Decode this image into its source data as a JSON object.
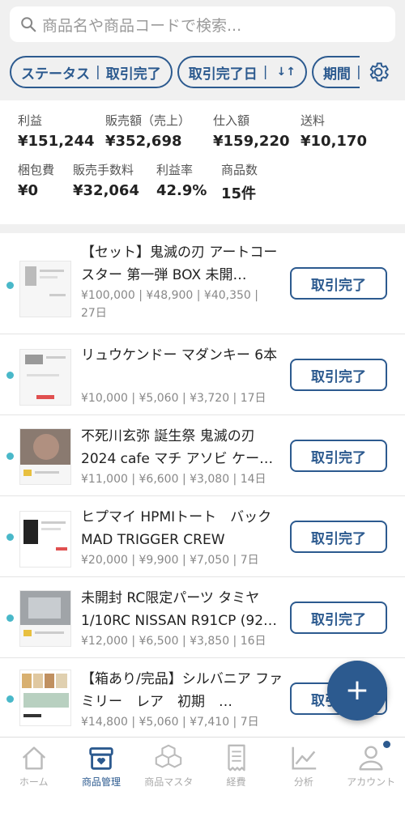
{
  "search": {
    "placeholder": "商品名や商品コードで検索..."
  },
  "filters": [
    {
      "label": "ステータス",
      "value": "取引完了"
    },
    {
      "label": "取引完了日",
      "sort": "↓↑"
    },
    {
      "label": "期間"
    }
  ],
  "summary": {
    "row1": [
      {
        "label": "利益",
        "value": "¥151,244"
      },
      {
        "label": "販売額（売上）",
        "value": "¥352,698"
      },
      {
        "label": "仕入額",
        "value": "¥159,220"
      },
      {
        "label": "送料",
        "value": "¥10,170"
      }
    ],
    "row2": [
      {
        "label": "梱包費",
        "value": "¥0"
      },
      {
        "label": "販売手数料",
        "value": "¥32,064"
      },
      {
        "label": "利益率",
        "value": "42.9%"
      },
      {
        "label": "商品数",
        "value": "15件"
      }
    ]
  },
  "items": [
    {
      "title": "【セット】鬼滅の刃 アートコースター 第一弾 BOX 未開…",
      "meta1": "¥100,000 | ¥48,900 | ¥40,350 |",
      "meta2": "27日",
      "status": "取引完了"
    },
    {
      "title": "リュウケンドー マダンキー 6本",
      "meta1": "¥10,000 | ¥5,060 | ¥3,720 | 17日",
      "meta2": "",
      "status": "取引完了"
    },
    {
      "title": "不死川玄弥 誕生祭 鬼滅の刃 2024 cafe マチ アソビ ケー…",
      "meta1": "¥11,000 | ¥6,600 | ¥3,080 | 14日",
      "meta2": "",
      "status": "取引完了"
    },
    {
      "title": "ヒプマイ HPMIトート　バック　MAD TRIGGER CREW",
      "meta1": "¥20,000 | ¥9,900 | ¥7,050 | 7日",
      "meta2": "",
      "status": "取引完了"
    },
    {
      "title": "未開封 RC限定パーツ タミヤ 1/10RC NISSAN R91CP (92…",
      "meta1": "¥12,000 | ¥6,500 | ¥3,850 | 16日",
      "meta2": "",
      "status": "取引完了"
    },
    {
      "title": "【箱あり/完品】シルバニア ファミリー　レア　初期　…",
      "meta1": "¥14,800 | ¥5,060 | ¥7,410 | 7日",
      "meta2": "",
      "status": "取引完了"
    }
  ],
  "fab": {
    "label": "+"
  },
  "nav": [
    {
      "label": "ホーム",
      "icon": "home-icon"
    },
    {
      "label": "商品管理",
      "icon": "box-icon",
      "active": true
    },
    {
      "label": "商品マスタ",
      "icon": "cubes-icon"
    },
    {
      "label": "経費",
      "icon": "receipt-icon"
    },
    {
      "label": "分析",
      "icon": "chart-icon"
    },
    {
      "label": "アカウント",
      "icon": "user-icon"
    }
  ],
  "colors": {
    "accent": "#2c5a8f",
    "unread_dot": "#49b8c9"
  }
}
